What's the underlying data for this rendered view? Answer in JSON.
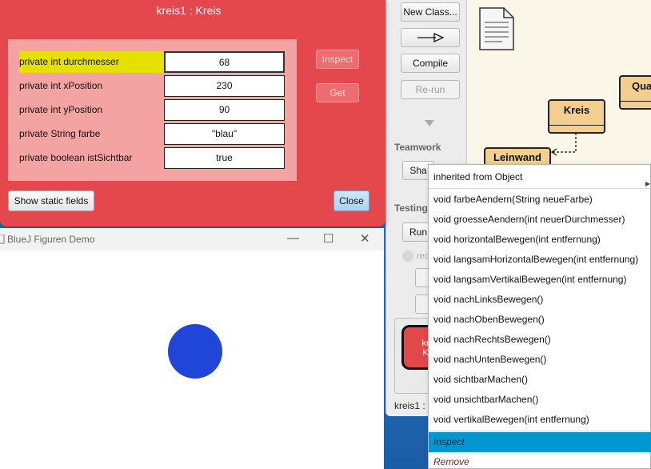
{
  "inspector": {
    "title": "kreis1 : Kreis",
    "fields": [
      {
        "name": "private int durchmesser",
        "value": "68"
      },
      {
        "name": "private int xPosition",
        "value": "230"
      },
      {
        "name": "private int yPosition",
        "value": "90"
      },
      {
        "name": "private String farbe",
        "value": "\"blau\""
      },
      {
        "name": "private boolean istSichtbar",
        "value": "true"
      }
    ],
    "inspect_label": "Inspect",
    "get_label": "Get",
    "show_static_label": "Show static fields",
    "close_label": "Close"
  },
  "demo_window": {
    "title": "BlueJ Figuren Demo",
    "minimize": "—",
    "maximize": "☐",
    "close": "✕",
    "circle_color": "#1f46d8"
  },
  "bluej": {
    "new_class_label": "New Class...",
    "arrow_label": "—▷",
    "compile_label": "Compile",
    "rerun_label": "Re-run",
    "teamwork_label": "Teamwork",
    "share_label": "Sha",
    "testing_label": "Testing",
    "run_label": "Run",
    "record_label": "rec",
    "classes": [
      {
        "name": "Kreis"
      },
      {
        "name": "Leinwand"
      },
      {
        "name": "Qua"
      }
    ],
    "object_bench": {
      "object_label": "kreis1 : K",
      "object_text_1": "kr",
      "object_text_2": "K"
    }
  },
  "context_menu": {
    "inherited": "inherited from Object",
    "methods": [
      "void farbeAendern(String neueFarbe)",
      "void groesseAendern(int neuerDurchmesser)",
      "void horizontalBewegen(int entfernung)",
      "void langsamHorizontalBewegen(int entfernung)",
      "void langsamVertikalBewegen(int entfernung)",
      "void nachLinksBewegen()",
      "void nachObenBewegen()",
      "void nachRechtsBewegen()",
      "void nachUntenBewegen()",
      "void sichtbarMachen()",
      "void unsichtbarMachen()",
      "void vertikalBewegen(int entfernung)"
    ],
    "inspect_label": "Inspect",
    "remove_label": "Remove"
  },
  "colors": {
    "inspector_bg": "#e4474c",
    "highlight_field": "#e6e000",
    "menu_highlight": "#0096cf",
    "class_fill": "#f3cf8f"
  }
}
